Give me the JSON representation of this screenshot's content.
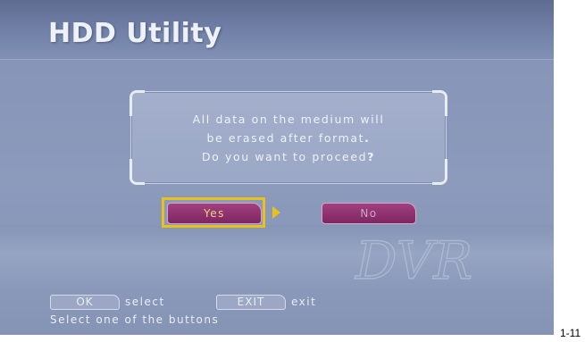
{
  "screen": {
    "title": "HDD Utility"
  },
  "dialog": {
    "line1": "All data on the medium will",
    "line2": "be erased after format",
    "line2_punct": ".",
    "line3": "Do you want to proceed",
    "line3_punct": "?"
  },
  "buttons": {
    "yes_label": "Yes",
    "no_label": "No",
    "focused": "Yes"
  },
  "footer": {
    "ok_key": "OK",
    "ok_desc": "select",
    "exit_key": "EXIT",
    "exit_desc": "exit",
    "hint": "Select one of the buttons"
  },
  "watermark": "DVR",
  "page_number": "1-11",
  "colors": {
    "background": "#8c9abc",
    "focus": "#e8c21a",
    "button": "#8e3070",
    "text": "#eef1f8"
  }
}
